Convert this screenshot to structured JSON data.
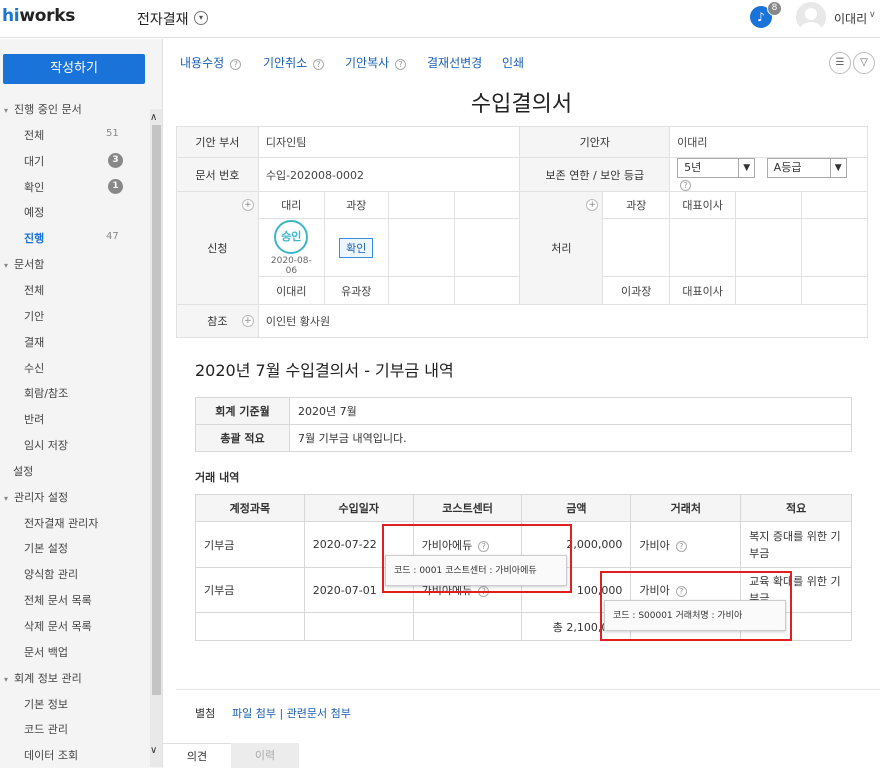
{
  "header": {
    "logo": "hiworks",
    "app_title": "전자결재",
    "notification_count": "8",
    "user_name": "이대리"
  },
  "sidebar": {
    "compose_label": "작성하기",
    "items": [
      {
        "label": "진행 중인 문서",
        "type": "section"
      },
      {
        "label": "전체",
        "count": "51",
        "type": "sub"
      },
      {
        "label": "대기",
        "badge": "3",
        "type": "sub"
      },
      {
        "label": "확인",
        "badge": "1",
        "type": "sub"
      },
      {
        "label": "예정",
        "type": "sub"
      },
      {
        "label": "진행",
        "count": "47",
        "type": "sub",
        "active": true
      },
      {
        "label": "문서함",
        "type": "section"
      },
      {
        "label": "전체",
        "type": "sub"
      },
      {
        "label": "기안",
        "type": "sub"
      },
      {
        "label": "결재",
        "type": "sub"
      },
      {
        "label": "수신",
        "type": "sub"
      },
      {
        "label": "회람/참조",
        "type": "sub"
      },
      {
        "label": "반려",
        "type": "sub"
      },
      {
        "label": "임시 저장",
        "type": "sub"
      },
      {
        "label": "설정",
        "type": "top"
      },
      {
        "label": "관리자 설정",
        "type": "section"
      },
      {
        "label": "전자결재 관리자",
        "type": "sub"
      },
      {
        "label": "기본 설정",
        "type": "sub"
      },
      {
        "label": "양식함 관리",
        "type": "sub"
      },
      {
        "label": "전체 문서 목록",
        "type": "sub"
      },
      {
        "label": "삭제 문서 목록",
        "type": "sub"
      },
      {
        "label": "문서 백업",
        "type": "sub"
      },
      {
        "label": "회계 정보 관리",
        "type": "section"
      },
      {
        "label": "기본 정보",
        "type": "sub"
      },
      {
        "label": "코드 관리",
        "type": "sub"
      },
      {
        "label": "데이터 조회",
        "type": "sub"
      }
    ]
  },
  "toolbar": {
    "edit": "내용수정",
    "cancel": "기안취소",
    "copy": "기안복사",
    "change_line": "결재선변경",
    "print": "인쇄"
  },
  "document": {
    "title": "수입결의서",
    "draft_dept_label": "기안 부서",
    "draft_dept": "디자인팀",
    "drafter_label": "기안자",
    "drafter": "이대리",
    "doc_no_label": "문서 번호",
    "doc_no": "수입-202008-0002",
    "retention_label": "보존 연한 / 보안 등급",
    "retention_value": "5년",
    "security_value": "A등급",
    "apply_label": "신청",
    "apply_roles": [
      "대리",
      "과장",
      "",
      ""
    ],
    "apply_names": [
      "이대리",
      "유과장",
      "",
      ""
    ],
    "stamp_text": "승인",
    "stamp_date": "2020-08-06",
    "confirm_label": "확인",
    "process_label": "처리",
    "process_roles": [
      "과장",
      "대표이사",
      "",
      ""
    ],
    "process_names": [
      "이과장",
      "대표이사",
      "",
      ""
    ],
    "ref_label": "참조",
    "ref_value": "이인턴 황사원"
  },
  "content": {
    "subtitle": "2020년 7월 수입결의서 - 기부금 내역",
    "basis_label": "회계 기준월",
    "basis_value": "2020년 7월",
    "summary_label": "총괄 적요",
    "summary_value": "7월 기부금 내역입니다.",
    "tx_label": "거래 내역",
    "tx_headers": [
      "계정과목",
      "수입일자",
      "코스트센터",
      "금액",
      "거래처",
      "적요"
    ],
    "tx_rows": [
      {
        "account": "기부금",
        "date": "2020-07-22",
        "cost_center": "가비아에듀",
        "amount": "2,000,000",
        "vendor": "가비아",
        "memo": "복지 증대를 위한 기부금"
      },
      {
        "account": "기부금",
        "date": "2020-07-01",
        "cost_center": "가비아에듀",
        "amount": "100,000",
        "vendor": "가비아",
        "memo": "교육 확대를 위한 기부금"
      }
    ],
    "total_text": "총 2,100,000",
    "tooltip_cost": "코드 : 0001  코스트센터 : 가비아에듀",
    "tooltip_vendor": "코드 : S00001  거래처명 : 가비아"
  },
  "footer": {
    "attach_label": "별첨",
    "attach_links": "파일 첨부 | 관련문서 첨부",
    "tab_opinion": "의견",
    "tab_history": "이력"
  },
  "colors": {
    "accent": "#1a73d9",
    "link": "#1a5fb4",
    "highlight": "#e02020",
    "stamp": "#3db5c9"
  }
}
